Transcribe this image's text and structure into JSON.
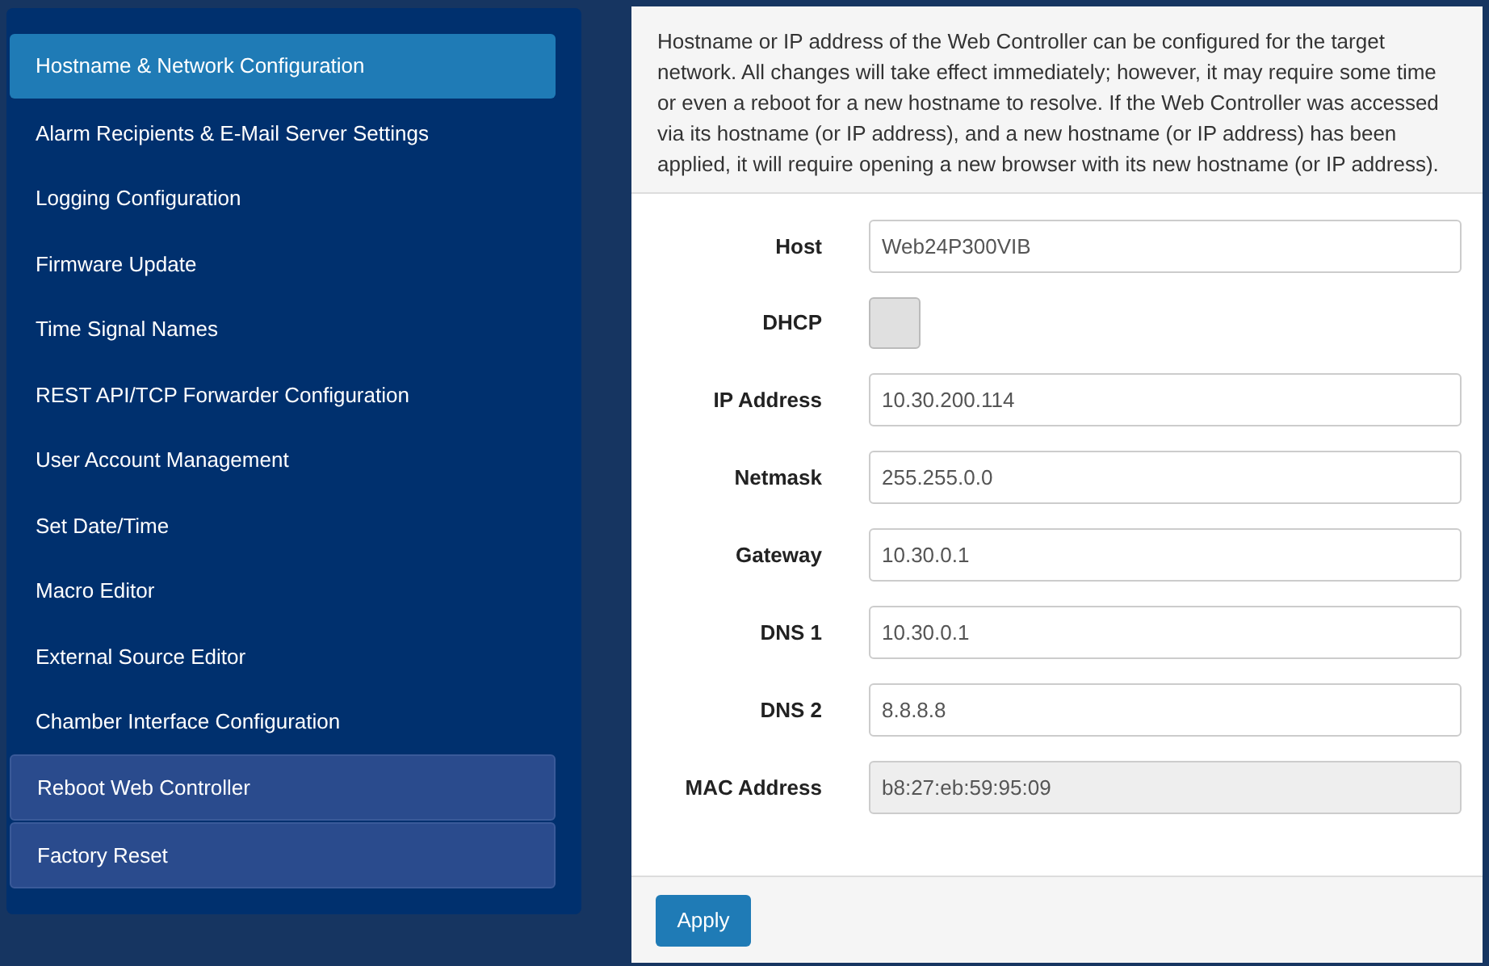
{
  "sidebar": {
    "items": [
      {
        "label": "Hostname & Network Configuration",
        "kind": "link",
        "selected": true
      },
      {
        "label": "Alarm Recipients & E-Mail Server Settings",
        "kind": "link",
        "selected": false
      },
      {
        "label": "Logging Configuration",
        "kind": "link",
        "selected": false
      },
      {
        "label": "Firmware Update",
        "kind": "link",
        "selected": false
      },
      {
        "label": "Time Signal Names",
        "kind": "link",
        "selected": false
      },
      {
        "label": "REST API/TCP Forwarder Configuration",
        "kind": "link",
        "selected": false
      },
      {
        "label": "User Account Management",
        "kind": "link",
        "selected": false
      },
      {
        "label": "Set Date/Time",
        "kind": "link",
        "selected": false
      },
      {
        "label": "Macro Editor",
        "kind": "link",
        "selected": false
      },
      {
        "label": "External Source Editor",
        "kind": "link",
        "selected": false
      },
      {
        "label": "Chamber Interface Configuration",
        "kind": "link",
        "selected": false
      },
      {
        "label": "Reboot Web Controller",
        "kind": "action",
        "selected": false
      },
      {
        "label": "Factory Reset",
        "kind": "action",
        "selected": false
      }
    ]
  },
  "panel": {
    "description": "Hostname or IP address of the Web Controller can be configured for the target network. All changes will take effect immediately; however, it may require some time or even a reboot for a new hostname to resolve. If the Web Controller was accessed via its hostname (or IP address), and a new hostname (or IP address) has been applied, it will require opening a new browser with its new hostname (or IP address).",
    "fields": [
      {
        "label": "Host",
        "kind": "text",
        "value": "Web24P300VIB",
        "disabled": false
      },
      {
        "label": "DHCP",
        "kind": "checkbox",
        "checked": false
      },
      {
        "label": "IP Address",
        "kind": "text",
        "value": "10.30.200.114",
        "disabled": false
      },
      {
        "label": "Netmask",
        "kind": "text",
        "value": "255.255.0.0",
        "disabled": false
      },
      {
        "label": "Gateway",
        "kind": "text",
        "value": "10.30.0.1",
        "disabled": false
      },
      {
        "label": "DNS 1",
        "kind": "text",
        "value": "10.30.0.1",
        "disabled": false
      },
      {
        "label": "DNS 2",
        "kind": "text",
        "value": "8.8.8.8",
        "disabled": false
      },
      {
        "label": "MAC Address",
        "kind": "text",
        "value": "b8:27:eb:59:95:09",
        "disabled": true
      }
    ],
    "apply_button": "Apply"
  }
}
